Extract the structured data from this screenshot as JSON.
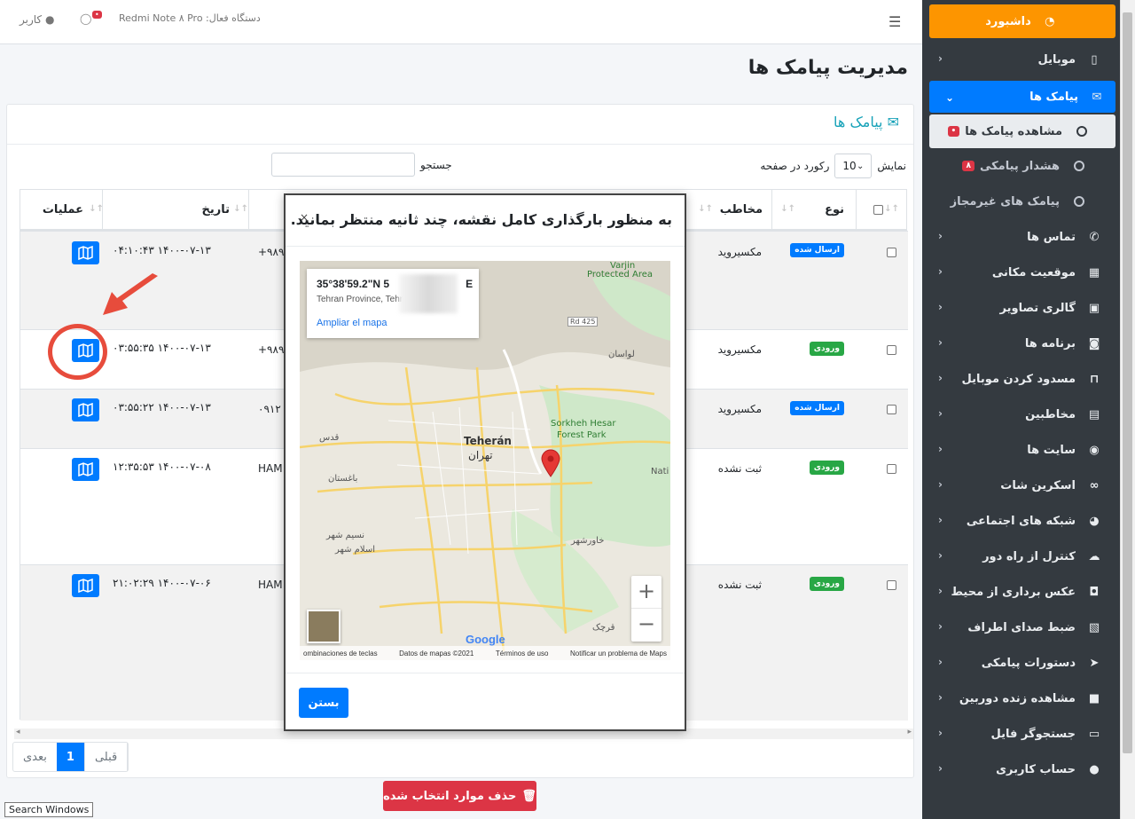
{
  "navbar": {
    "device": "دستگاه فعال: Redmi Note ۸ Pro",
    "chat_badge": "",
    "user": "کاربر"
  },
  "sidebar": {
    "items": [
      {
        "label": "داشبورد",
        "icon": "dashboard-icon"
      },
      {
        "label": "موبایل",
        "icon": "mobile-icon"
      },
      {
        "label": "پیامک ها",
        "icon": "envelope-icon"
      },
      {
        "label": "مشاهده پیامک ها",
        "icon": "circle-icon"
      },
      {
        "label": "هشدار پیامکی",
        "icon": "circle-icon",
        "badge": "۸"
      },
      {
        "label": "پیامک های غیرمجاز",
        "icon": "circle-icon"
      },
      {
        "label": "تماس ها",
        "icon": "phone-icon"
      },
      {
        "label": "موقعیت مکانی",
        "icon": "map-icon"
      },
      {
        "label": "گالری تصاویر",
        "icon": "image-icon"
      },
      {
        "label": "برنامه ها",
        "icon": "gamepad-icon"
      },
      {
        "label": "مسدود کردن موبایل",
        "icon": "lock-icon"
      },
      {
        "label": "مخاطبین",
        "icon": "address-book-icon"
      },
      {
        "label": "سایت ها",
        "icon": "chrome-icon"
      },
      {
        "label": "اسکرین شات",
        "icon": "binoculars-icon"
      },
      {
        "label": "شبکه های اجتماعی",
        "icon": "eye-icon"
      },
      {
        "label": "کنترل از راه دور",
        "icon": "cloud-icon"
      },
      {
        "label": "عکس برداری از محیط",
        "icon": "camera-icon"
      },
      {
        "label": "ضبط صدای اطراف",
        "icon": "audio-file-icon"
      },
      {
        "label": "دستورات پیامکی",
        "icon": "paper-plane-icon"
      },
      {
        "label": "مشاهده زنده دوربین",
        "icon": "video-icon"
      },
      {
        "label": "جستجوگر فایل",
        "icon": "folder-icon"
      },
      {
        "label": "حساب کاربری",
        "icon": "user-icon"
      }
    ]
  },
  "page": {
    "title": "مدیریت پیامک ها",
    "card_title": "پیامک ها",
    "show_label": "نمایش",
    "show_value": "10",
    "per_page_label": "رکورد در صفحه",
    "search_label": "جستجو"
  },
  "table": {
    "headers": {
      "type": "نوع",
      "contact": "مخاطب",
      "date": "تاریخ",
      "actions": "عملیات"
    },
    "rows": [
      {
        "status": "ارسال شده",
        "kind": "sent",
        "contact": "مکسیروید",
        "number": "+۹۸۹",
        "date": "۰۴:۱۰:۴۳ ۱۴۰۰-۰۷-۱۳"
      },
      {
        "status": "ورودی",
        "kind": "in",
        "contact": "مکسیروید",
        "number": "+۹۸۹",
        "date": "۰۳:۵۵:۳۵ ۱۴۰۰-۰۷-۱۳"
      },
      {
        "status": "ارسال شده",
        "kind": "sent",
        "contact": "مکسیروید",
        "number": "۰۹۱۲",
        "date": "۰۳:۵۵:۲۲ ۱۴۰۰-۰۷-۱۳"
      },
      {
        "status": "ورودی",
        "kind": "in",
        "contact": "ثبت نشده",
        "number": "HAM",
        "date": "۱۲:۳۵:۵۳ ۱۴۰۰-۰۷-۰۸"
      },
      {
        "status": "ورودی",
        "kind": "in",
        "contact": "ثبت نشده",
        "number": "HAM",
        "date": "۲۱:۰۲:۲۹ ۱۴۰۰-۰۷-۰۶"
      }
    ]
  },
  "pager": {
    "prev": "قبلی",
    "current": "1",
    "next": "بعدی"
  },
  "delete_button": "حذف موارد انتخاب شده",
  "tooltip": "Search Windows",
  "modal": {
    "title": "به منظور بارگذاری کامل نقشه، چند ثانیه منتظر بمانید.",
    "close_x": "×",
    "coord": "35°38'59.2\"N 5",
    "coord_end": "E",
    "coord_sub": "Tehran Province, Tehr",
    "enlarge": "Ampliar el mapa",
    "zoom_in": "+",
    "zoom_out": "−",
    "google": "Google",
    "footer": [
      "ombinaciones de teclas",
      "Datos de mapas ©2021",
      "Términos de uso",
      "Notificar un problema de Maps"
    ],
    "labels": {
      "tehran_latin": "Teherán",
      "tehran_fa": "تهران",
      "sorkheh": "Sorkheh Hesar",
      "forest": "Forest Park",
      "varjin": "Varjin",
      "protected": "Protected Area",
      "qods": "قدس",
      "baghestan": "باغستان",
      "eslamshahr": "اسلام شهر",
      "nasimshahr": "نسیم شهر",
      "qarchak": "قرچک",
      "nati": "Nati",
      "lavasan": "لواسان",
      "khavarshahr": "خاورشهر",
      "rd": "Rd 425"
    },
    "close_button": "بستن"
  }
}
